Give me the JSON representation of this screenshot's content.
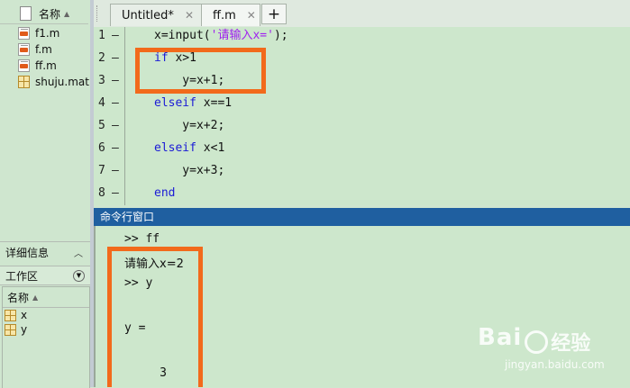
{
  "file_browser": {
    "header_label": "名称",
    "files": [
      {
        "name": "f1.m",
        "icon": "m-file-icon"
      },
      {
        "name": "f.m",
        "icon": "m-file-icon"
      },
      {
        "name": "ff.m",
        "icon": "m-file-icon"
      },
      {
        "name": "shuju.mat",
        "icon": "mat-file-icon"
      }
    ]
  },
  "details": {
    "label": "详细信息"
  },
  "workspace": {
    "title": "工作区",
    "header_label": "名称",
    "variables": [
      {
        "name": "x"
      },
      {
        "name": "y"
      }
    ]
  },
  "editor": {
    "tabs": [
      {
        "label": "Untitled*",
        "active": false
      },
      {
        "label": "ff.m",
        "active": true
      }
    ],
    "add_tab": "+",
    "lines": [
      {
        "num": "1",
        "marker": "—",
        "segments": [
          {
            "t": "x=input(",
            "c": ""
          },
          {
            "t": "'请输入x='",
            "c": "str"
          },
          {
            "t": ");",
            "c": ""
          }
        ]
      },
      {
        "num": "2",
        "marker": "—",
        "segments": [
          {
            "t": "if",
            "c": "kw"
          },
          {
            "t": " x>1",
            "c": ""
          }
        ]
      },
      {
        "num": "3",
        "marker": "—",
        "segments": [
          {
            "t": "    y=x+1;",
            "c": ""
          }
        ]
      },
      {
        "num": "4",
        "marker": "—",
        "segments": [
          {
            "t": "elseif",
            "c": "kw"
          },
          {
            "t": " x==1",
            "c": ""
          }
        ]
      },
      {
        "num": "5",
        "marker": "—",
        "segments": [
          {
            "t": "    y=x+2;",
            "c": ""
          }
        ]
      },
      {
        "num": "6",
        "marker": "—",
        "segments": [
          {
            "t": "elseif",
            "c": "kw"
          },
          {
            "t": " x<1",
            "c": ""
          }
        ]
      },
      {
        "num": "7",
        "marker": "—",
        "segments": [
          {
            "t": "    y=x+3;",
            "c": ""
          }
        ]
      },
      {
        "num": "8",
        "marker": "—",
        "segments": [
          {
            "t": "end",
            "c": "kw"
          }
        ]
      }
    ]
  },
  "command_window": {
    "title": "命令行窗口",
    "lines": [
      ">> ff",
      "请输入x=2",
      ">> y",
      "",
      "y =",
      "",
      "     3"
    ]
  },
  "watermark": {
    "brand": "Bai",
    "brand2": "经验",
    "url": "jingyan.baidu.com"
  },
  "colors": {
    "highlight": "#f26a1b",
    "background": "#cde7cc",
    "keyword": "#1b1bd6",
    "string": "#a020f0",
    "title_bar": "#1f5fa0"
  }
}
